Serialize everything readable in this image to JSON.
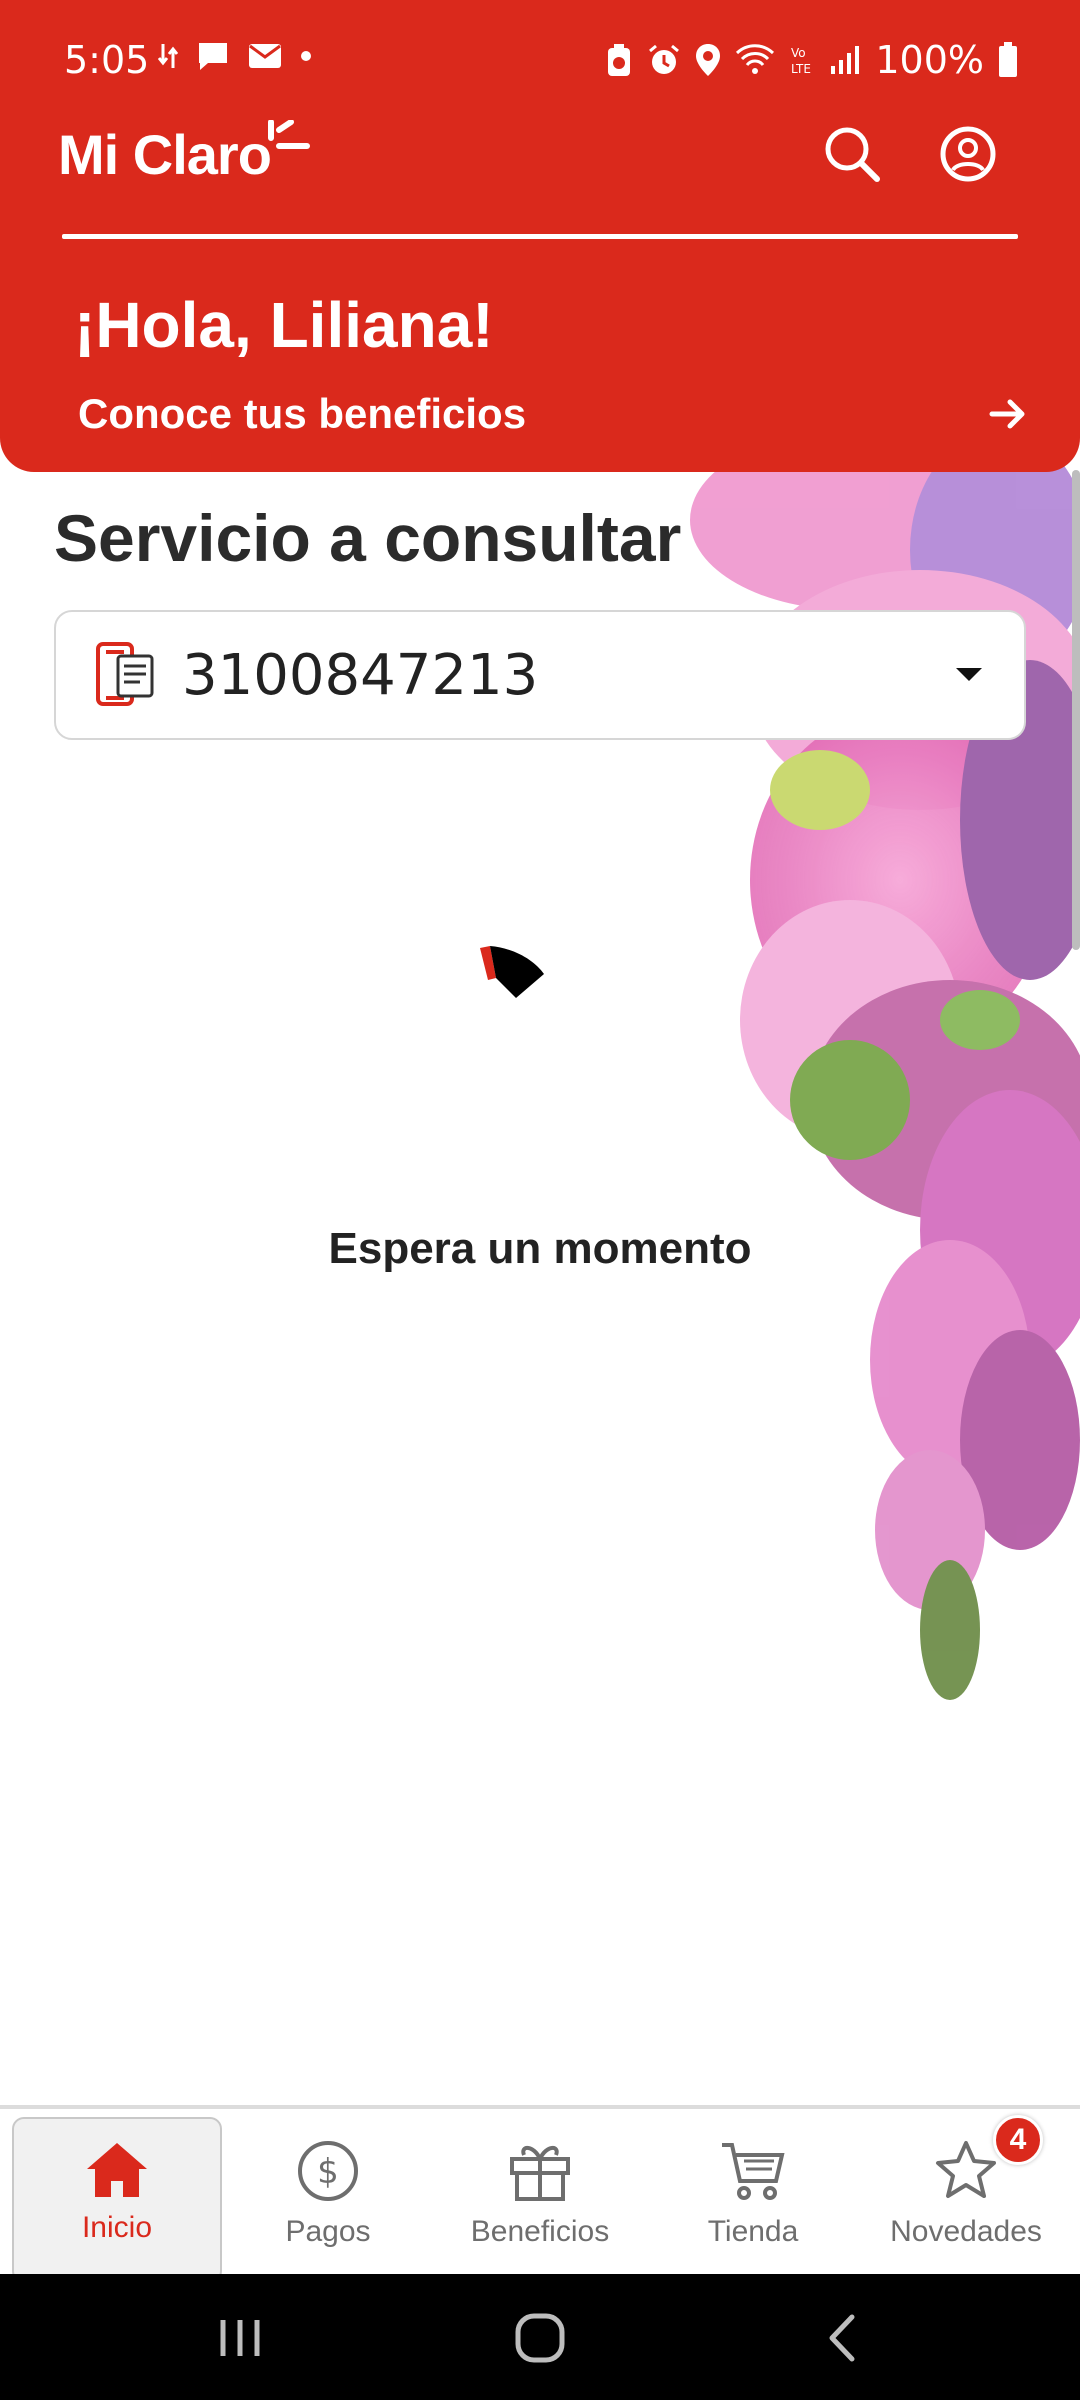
{
  "status_bar": {
    "time": "5:05",
    "battery": "100%"
  },
  "header": {
    "logo_text": "Mi Claro",
    "greeting": "¡Hola, Liliana!",
    "benefits_link": "Conoce tus beneficios",
    "accent_color": "#da291c"
  },
  "main": {
    "section_title": "Servicio a consultar",
    "service_number": "3100847213",
    "loading_text": "Espera un momento"
  },
  "bottom_nav": {
    "items": [
      {
        "label": "Inicio",
        "icon": "home-icon",
        "active": true
      },
      {
        "label": "Pagos",
        "icon": "dollar-icon"
      },
      {
        "label": "Beneficios",
        "icon": "gift-icon"
      },
      {
        "label": "Tienda",
        "icon": "cart-icon"
      },
      {
        "label": "Novedades",
        "icon": "star-icon",
        "badge": "4"
      }
    ]
  },
  "system_nav": {
    "buttons": [
      "recents-icon",
      "home-circle-icon",
      "back-icon"
    ]
  }
}
